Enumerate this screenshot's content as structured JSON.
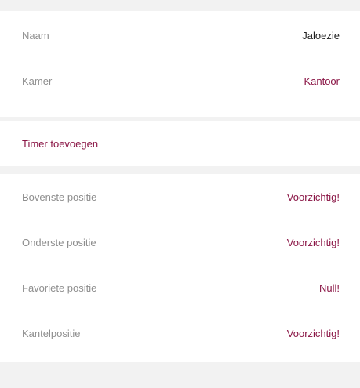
{
  "colors": {
    "accent": "#8a1545",
    "background": "#f2f2f2",
    "card": "#ffffff",
    "label_text": "#8e8e8e",
    "value_text": "#1f1f1f"
  },
  "details": {
    "name_label": "Naam",
    "name_value": "Jaloezie",
    "room_label": "Kamer",
    "room_value": "Kantoor"
  },
  "timer": {
    "add_label": "Timer toevoegen"
  },
  "positions": {
    "top_label": "Bovenste positie",
    "top_value": "Voorzichtig!",
    "bottom_label": "Onderste positie",
    "bottom_value": "Voorzichtig!",
    "favorite_label": "Favoriete positie",
    "favorite_value": "Null!",
    "tilt_label": "Kantelpositie",
    "tilt_value": "Voorzichtig!"
  }
}
